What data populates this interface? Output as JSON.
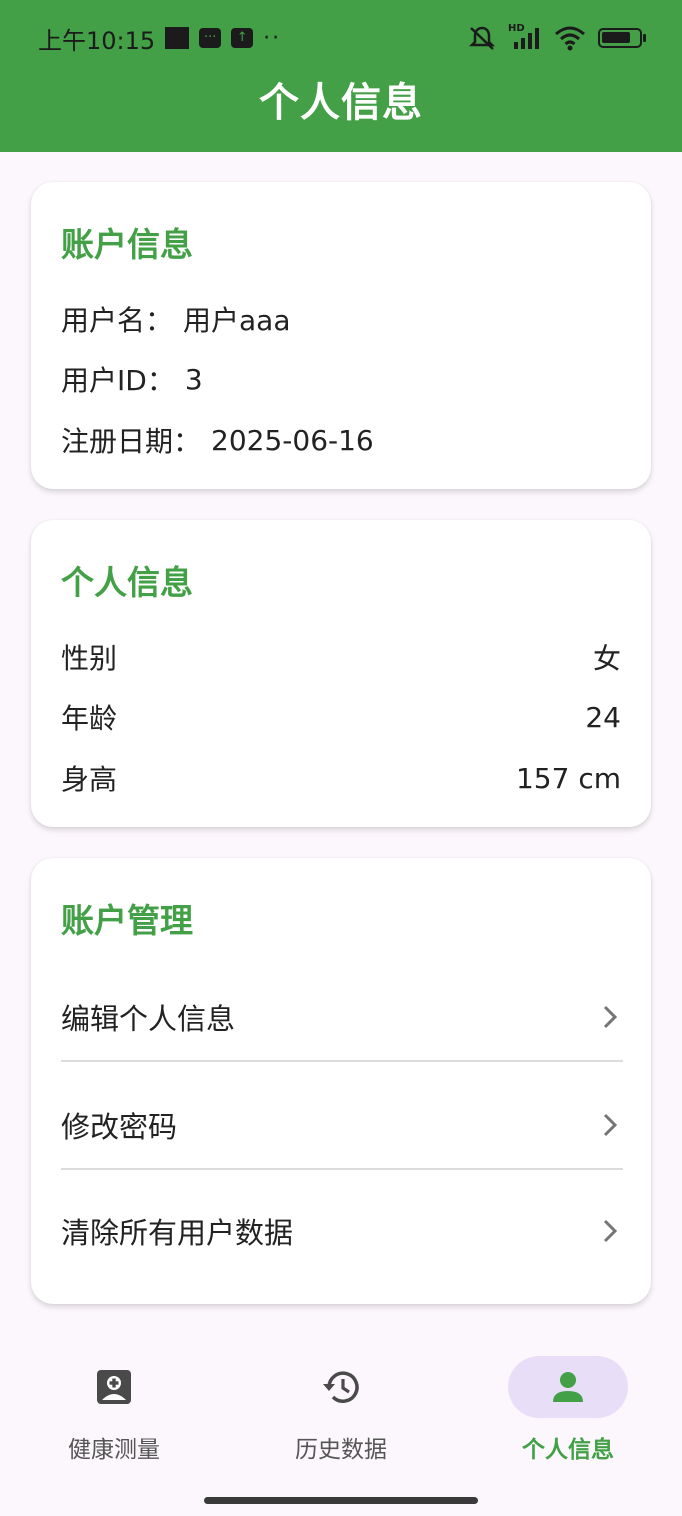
{
  "status_bar": {
    "time": "上午10:15",
    "network_label": "HD"
  },
  "app_bar": {
    "title": "个人信息"
  },
  "account_card": {
    "title": "账户信息",
    "username_label": "用户名：",
    "username_value": "用户aaa",
    "userid_label": "用户ID：",
    "userid_value": "3",
    "regdate_label": "注册日期：",
    "regdate_value": "2025-06-16"
  },
  "personal_card": {
    "title": "个人信息",
    "rows": [
      {
        "label": "性别",
        "value": "女"
      },
      {
        "label": "年龄",
        "value": "24"
      },
      {
        "label": "身高",
        "value": "157 cm"
      }
    ]
  },
  "manage_card": {
    "title": "账户管理",
    "items": [
      {
        "label": "编辑个人信息"
      },
      {
        "label": "修改密码"
      },
      {
        "label": "清除所有用户数据"
      }
    ]
  },
  "bottom_nav": {
    "items": [
      {
        "label": "健康测量",
        "icon": "health-measure-icon",
        "active": false
      },
      {
        "label": "历史数据",
        "icon": "history-icon",
        "active": false
      },
      {
        "label": "个人信息",
        "icon": "person-icon",
        "active": true
      }
    ]
  },
  "colors": {
    "primary": "#43a047",
    "active_indicator": "#e8def8",
    "background": "#fcf7fc"
  }
}
